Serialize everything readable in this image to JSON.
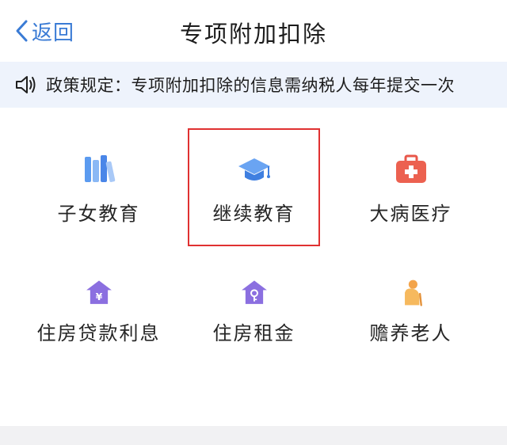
{
  "navbar": {
    "back_label": "返回",
    "title": "专项附加扣除",
    "back_icon": "chevron-left-icon"
  },
  "notice": {
    "icon": "speaker-icon",
    "text": "政策规定：专项附加扣除的信息需纳税人每年提交一次"
  },
  "categories": [
    {
      "label": "子女教育",
      "icon": "books-icon"
    },
    {
      "label": "继续教育",
      "icon": "graduation-cap-icon",
      "highlighted": true
    },
    {
      "label": "大病医疗",
      "icon": "medical-kit-icon"
    },
    {
      "label": "住房贷款利息",
      "icon": "house-yen-icon"
    },
    {
      "label": "住房租金",
      "icon": "house-key-icon"
    },
    {
      "label": "赡养老人",
      "icon": "elderly-person-icon"
    }
  ],
  "colors": {
    "accent": "#3a7bd5",
    "notice_bg": "#eef3fc",
    "highlight_border": "#e03131"
  }
}
